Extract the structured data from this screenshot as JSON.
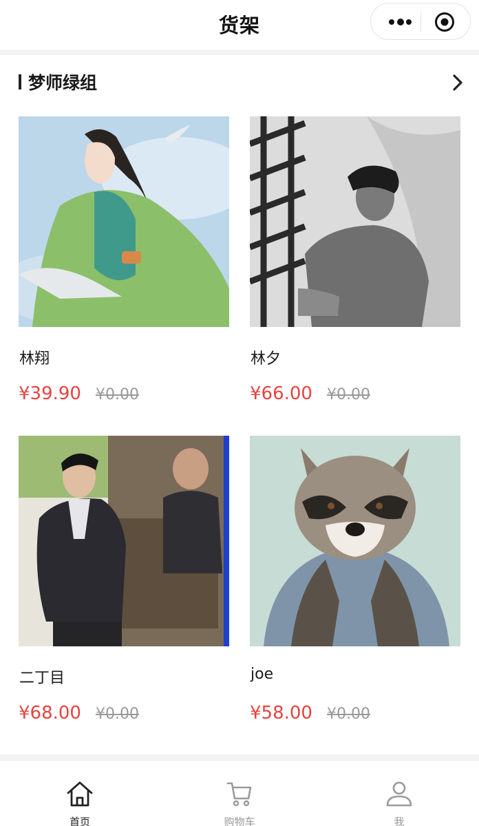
{
  "nav": {
    "title": "货架"
  },
  "section": {
    "title": "梦师绿组"
  },
  "products": [
    {
      "name": "林翔",
      "price": "¥39.90",
      "original_price": "¥0.00"
    },
    {
      "name": "林夕",
      "price": "¥66.00",
      "original_price": "¥0.00"
    },
    {
      "name": "二丁目",
      "price": "¥68.00",
      "original_price": "¥0.00"
    },
    {
      "name": "joe",
      "price": "¥58.00",
      "original_price": "¥0.00"
    }
  ],
  "tabbar": {
    "items": [
      {
        "label": "首页",
        "icon": "home-icon",
        "active": true
      },
      {
        "label": "购物车",
        "icon": "cart-icon",
        "active": false
      },
      {
        "label": "我",
        "icon": "user-icon",
        "active": false
      }
    ]
  },
  "colors": {
    "price": "#e64340",
    "original_price": "#999999",
    "text": "#222222",
    "tab_inactive": "#999999"
  }
}
